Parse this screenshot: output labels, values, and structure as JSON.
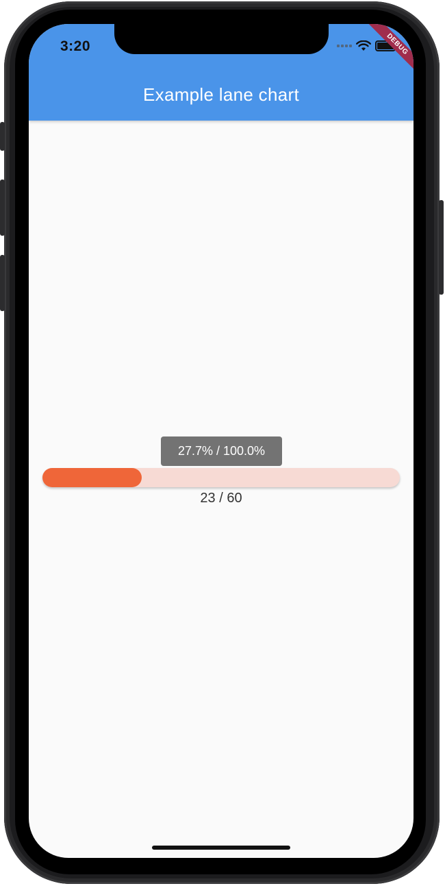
{
  "status_bar": {
    "time": "3:20",
    "icons": [
      "signal-icon",
      "wifi-icon",
      "battery-icon"
    ]
  },
  "appbar": {
    "title": "Example lane chart",
    "color": "#4a94e9"
  },
  "debug_banner": "DEBUG",
  "chart_data": {
    "type": "bar",
    "orientation": "horizontal",
    "value": 23,
    "max": 60,
    "percent_label": "27.7% / 100.0%",
    "count_label": "23 / 60",
    "fill_color": "#ef6639",
    "track_color": "#f7dad4",
    "fill_fraction": 0.277
  }
}
